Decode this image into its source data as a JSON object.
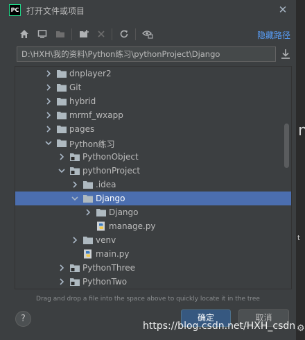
{
  "window": {
    "title": "打开文件或项目",
    "app_logo": "PC"
  },
  "toolbar": {
    "buttons": [
      {
        "name": "home-icon"
      },
      {
        "name": "desktop-icon"
      },
      {
        "name": "project-folder-icon"
      },
      {
        "name": "new-folder-icon"
      },
      {
        "name": "delete-icon"
      },
      {
        "name": "refresh-icon"
      },
      {
        "name": "show-hidden-icon"
      }
    ],
    "hidden_paths_link": "隐藏路径"
  },
  "path": {
    "value": "D:\\HXH\\我的资料\\Python练习\\pythonProject\\Django"
  },
  "tree": {
    "items": [
      {
        "label": "dnplayer2",
        "expanded": false,
        "kind": "folder"
      },
      {
        "label": "Git",
        "expanded": false,
        "kind": "folder"
      },
      {
        "label": "hybrid",
        "expanded": false,
        "kind": "folder"
      },
      {
        "label": "mrmf_wxapp",
        "expanded": false,
        "kind": "folder"
      },
      {
        "label": "pages",
        "expanded": false,
        "kind": "folder"
      },
      {
        "label": "Python练习",
        "expanded": true,
        "kind": "folder"
      },
      {
        "label": "PythonObject",
        "expanded": false,
        "kind": "project"
      },
      {
        "label": "pythonProject",
        "expanded": true,
        "kind": "project"
      },
      {
        "label": ".idea",
        "expanded": false,
        "kind": "folder"
      },
      {
        "label": "Django",
        "expanded": true,
        "kind": "folder",
        "selected": true
      },
      {
        "label": "Django",
        "expanded": false,
        "kind": "folder"
      },
      {
        "label": "manage.py",
        "kind": "python-file"
      },
      {
        "label": "venv",
        "expanded": false,
        "kind": "folder"
      },
      {
        "label": "main.py",
        "kind": "python-file"
      },
      {
        "label": "PythonThree",
        "expanded": false,
        "kind": "project"
      },
      {
        "label": "PythonTwo",
        "expanded": false,
        "kind": "project"
      }
    ]
  },
  "hint": "Drag and drop a file into the space above to quickly locate it in the tree",
  "buttons": {
    "help": "?",
    "ok": "确定",
    "cancel": "取消"
  },
  "watermark": "https://blog.csdn.net/HXH_csdn",
  "colors": {
    "dialog_bg": "#3c3f41",
    "selection": "#4b6eaf",
    "link": "#589df6",
    "ok_bg": "#365880",
    "folder": "#aeb9c0"
  }
}
